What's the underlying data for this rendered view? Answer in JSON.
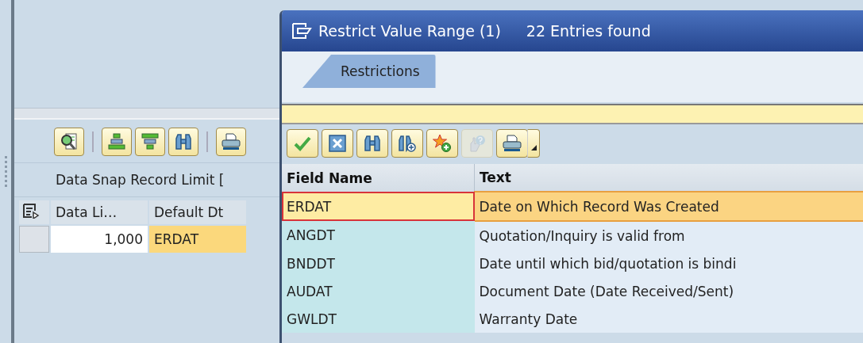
{
  "background_app": {
    "toolbar": [
      {
        "kind": "details"
      },
      {
        "kind": "sort"
      },
      {
        "kind": "filter"
      },
      {
        "kind": "find"
      },
      {
        "kind": "print"
      }
    ],
    "label": "Data Snap Record Limit [",
    "table": {
      "columns": [
        "Data Li…",
        "Default Dt"
      ],
      "rows": [
        {
          "data_limit": "1,000",
          "default_date": "ERDAT",
          "selected": true
        }
      ]
    }
  },
  "dialog": {
    "title": "Restrict Value Range (1)",
    "count": "22 Entries found",
    "tabs": [
      {
        "label": "Restrictions",
        "selected": true
      }
    ],
    "toolbar": [
      {
        "kind": "confirm",
        "disabled": false
      },
      {
        "kind": "cancel",
        "disabled": false
      },
      {
        "kind": "find",
        "disabled": false
      },
      {
        "kind": "find_next",
        "disabled": false
      },
      {
        "kind": "favorite",
        "disabled": false
      },
      {
        "kind": "help",
        "disabled": true
      },
      {
        "kind": "print",
        "disabled": false
      }
    ],
    "table": {
      "columns": [
        "Field Name",
        "Text"
      ],
      "rows": [
        {
          "field_name": "ERDAT",
          "text": "Date on Which Record Was Created",
          "selected": true
        },
        {
          "field_name": "ANGDT",
          "text": "Quotation/Inquiry is valid from",
          "selected": false
        },
        {
          "field_name": "BNDDT",
          "text": "Date until which bid/quotation is bindi",
          "selected": false
        },
        {
          "field_name": "AUDAT",
          "text": "Document Date (Date Received/Sent)",
          "selected": false
        },
        {
          "field_name": "GWLDT",
          "text": "Warranty Date",
          "selected": false
        }
      ]
    }
  }
}
